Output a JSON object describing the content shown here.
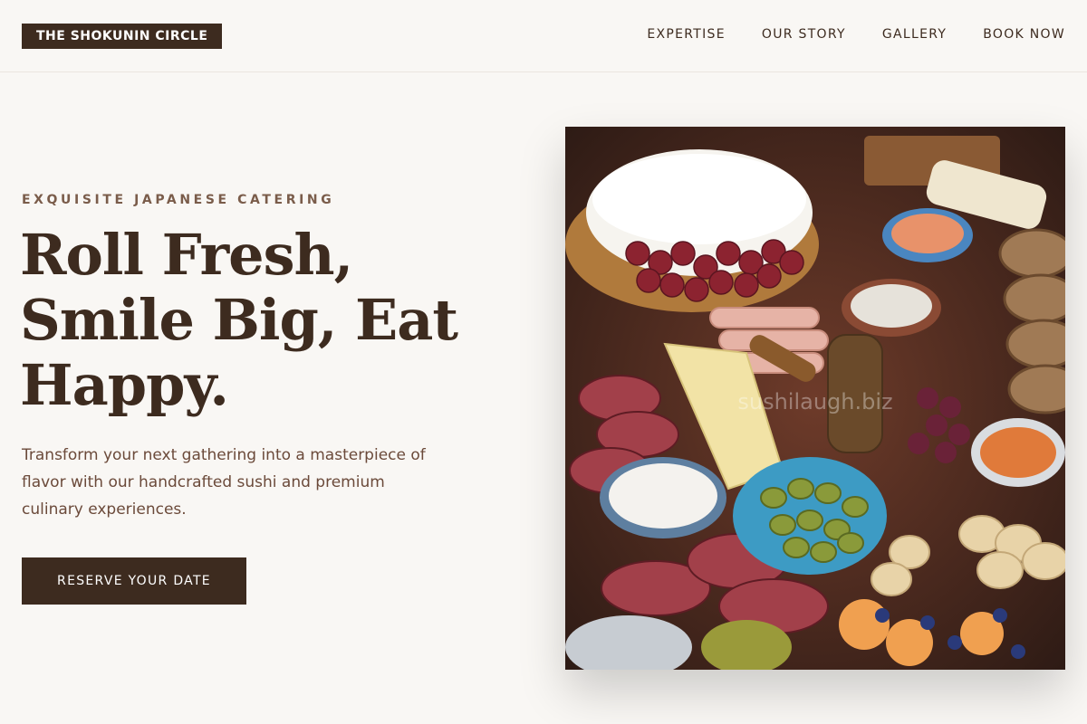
{
  "header": {
    "logo": "THE SHOKUNIN CIRCLE",
    "nav": [
      {
        "label": "EXPERTISE"
      },
      {
        "label": "OUR STORY"
      },
      {
        "label": "GALLERY"
      },
      {
        "label": "BOOK NOW"
      }
    ]
  },
  "hero": {
    "eyebrow": "EXQUISITE JAPANESE CATERING",
    "headline": "Roll Fresh, Smile Big, Eat Happy.",
    "lead": "Transform your next gathering into a masterpiece of flavor with our handcrafted sushi and premium culinary experiences.",
    "cta_label": "RESERVE YOUR DATE",
    "image_watermark": "sushilaugh.biz"
  },
  "colors": {
    "brand_dark": "#3d2b1f",
    "accent_brown": "#7a5c4a",
    "background": "#f9f7f4"
  }
}
